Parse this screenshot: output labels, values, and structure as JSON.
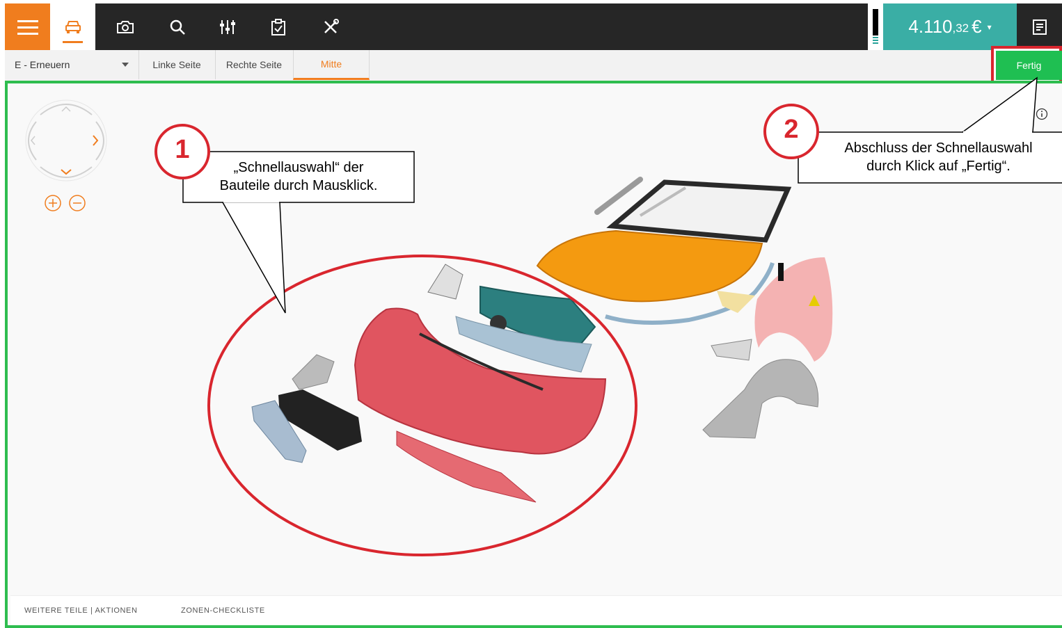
{
  "toolbar": {
    "icons": [
      "menu-icon",
      "car-icon",
      "camera-icon",
      "search-icon",
      "sliders-icon",
      "clipboard-check-icon",
      "tools-icon",
      "receipt-icon"
    ],
    "price_main": "4.110",
    "price_cents": ",32",
    "price_currency": "€",
    "accent_color": "#f07d1e",
    "price_bg_color": "#3aaea5"
  },
  "tabbar": {
    "mode_select": "E - Erneuern",
    "tabs": [
      {
        "label": "Linke Seite",
        "active": false
      },
      {
        "label": "Rechte Seite",
        "active": false
      },
      {
        "label": "Mitte",
        "active": true
      }
    ],
    "done_button": "Fertig",
    "done_color": "#1fbf52"
  },
  "annotations": {
    "callout1_number": "1",
    "callout1_line1": "„Schnellauswahl“ der",
    "callout1_line2": "Bauteile durch Mausklick.",
    "callout2_number": "2",
    "callout2_line1": "Abschluss der Schnellauswahl",
    "callout2_line2": "durch Klick auf „Fertig“.",
    "highlight_color": "#d9262e"
  },
  "footer": {
    "link1": "WEITERE TEILE | AKTIONEN",
    "link2": "ZONEN-CHECKLISTE"
  },
  "viewport": {
    "border_color": "#2ebd4f"
  }
}
